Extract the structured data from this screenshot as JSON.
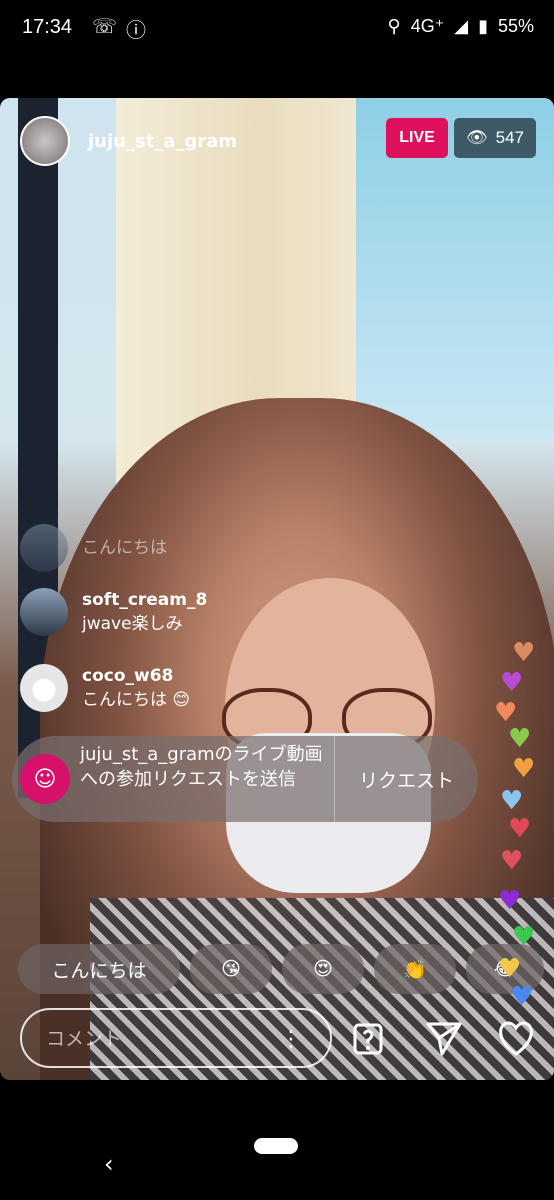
{
  "status_bar": {
    "time": "17:34",
    "network": "4G⁺",
    "battery": "55%"
  },
  "host": {
    "username": "juju_st_a_gram"
  },
  "live_badge": "LIVE",
  "viewer_count": "547",
  "comments": [
    {
      "username": "",
      "text": "こんにちは"
    },
    {
      "username": "soft_cream_8",
      "text": "jwave楽しみ"
    },
    {
      "username": "coco_w68",
      "text": "こんにちは 😊"
    }
  ],
  "request_card": {
    "message": "juju_st_a_gramのライブ動画への参加リクエストを送信",
    "button": "リクエスト"
  },
  "quick_replies": [
    "こんにちは",
    "😘",
    "😍",
    "👏",
    "😂"
  ],
  "comment_field": {
    "placeholder": "コメント"
  },
  "colors": {
    "live": "#e0115c",
    "badge": "#d6106b"
  }
}
